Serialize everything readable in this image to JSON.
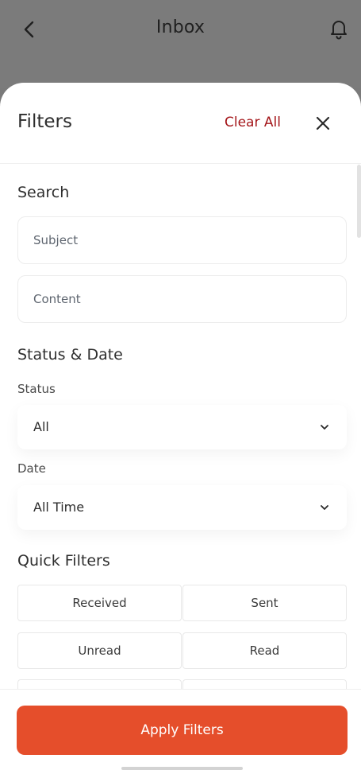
{
  "appbar": {
    "title": "Inbox"
  },
  "sheet": {
    "title": "Filters",
    "clear_all": "Clear All"
  },
  "search": {
    "title": "Search",
    "subject_placeholder": "Subject",
    "content_placeholder": "Content"
  },
  "status_date": {
    "title": "Status & Date",
    "status_label": "Status",
    "status_value": "All",
    "date_label": "Date",
    "date_value": "All Time"
  },
  "quick_filters": {
    "title": "Quick Filters",
    "items": [
      "Received",
      "Sent",
      "Unread",
      "Read"
    ]
  },
  "footer": {
    "apply_label": "Apply Filters"
  },
  "colors": {
    "accent": "#e54e2b",
    "clear_all": "#a4161a"
  }
}
